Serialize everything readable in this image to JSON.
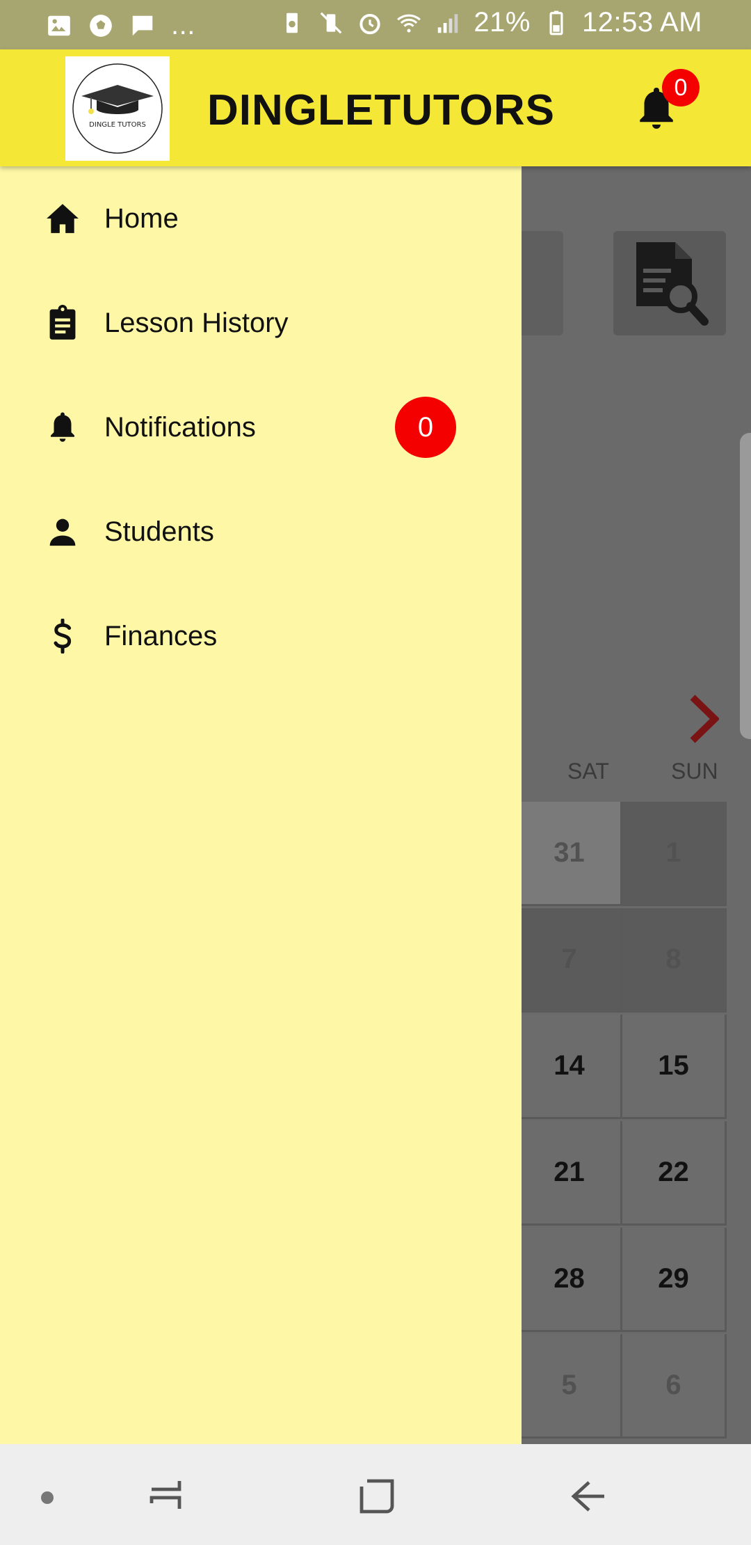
{
  "status_bar": {
    "left_icons": [
      "image-icon",
      "soccer-ball-icon",
      "message-icon"
    ],
    "overflow": "...",
    "battery_percent": "21%",
    "time": "12:53 AM",
    "right_icons": [
      "battery-saver-icon",
      "vibrate-mute-icon",
      "alarm-icon",
      "wifi-icon",
      "signal-icon",
      "battery-icon"
    ]
  },
  "app_bar": {
    "logo_text": "DINGLE TUTORS",
    "title": "DINGLETUTORS",
    "notification_count": "0"
  },
  "drawer": {
    "items": [
      {
        "label": "Home",
        "icon": "home-icon"
      },
      {
        "label": "Lesson History",
        "icon": "clipboard-icon"
      },
      {
        "label": "Notifications",
        "icon": "bell-icon",
        "badge": "0"
      },
      {
        "label": "Students",
        "icon": "person-icon"
      },
      {
        "label": "Finances",
        "icon": "dollar-icon"
      }
    ]
  },
  "calendar": {
    "day_headers": [
      "SAT",
      "SUN"
    ],
    "rows": [
      [
        "31",
        "1"
      ],
      [
        "7",
        "8"
      ],
      [
        "14",
        "15"
      ],
      [
        "21",
        "22"
      ],
      [
        "28",
        "29"
      ],
      [
        "5",
        "6"
      ]
    ]
  },
  "colors": {
    "app_bar": "#f4e735",
    "drawer": "#fdf7a6",
    "badge": "#f40000",
    "status_bar": "#a8a670"
  }
}
